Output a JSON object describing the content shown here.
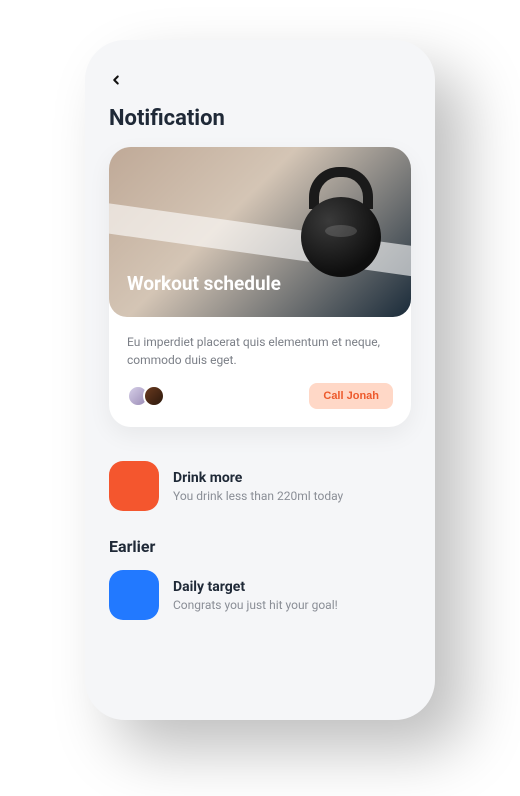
{
  "header": {
    "title": "Notification"
  },
  "card": {
    "hero_title": "Workout schedule",
    "description": "Eu imperdiet placerat quis elementum et neque, commodo duis eget.",
    "action_label": "Call Jonah"
  },
  "notifications": {
    "current": [
      {
        "title": "Drink more",
        "subtitle": "You drink less than 220ml today",
        "color": "#f4562e"
      }
    ],
    "earlier_label": "Earlier",
    "earlier": [
      {
        "title": "Daily target",
        "subtitle": "Congrats you just hit your goal!",
        "color": "#2279ff"
      }
    ]
  }
}
